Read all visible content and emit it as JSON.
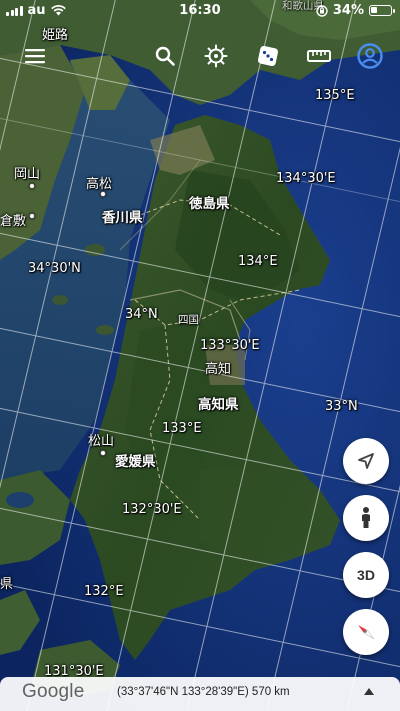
{
  "status_bar": {
    "carrier": "au",
    "time": "16:30",
    "battery": "34%"
  },
  "toolbar": {
    "buttons": [
      "menu-icon",
      "search-icon",
      "voyager-icon",
      "feeling-lucky-icon",
      "measure-icon",
      "account-icon"
    ],
    "accent_color": "#4a8df0"
  },
  "map": {
    "grid_labels": {
      "lon_135": "135°E",
      "lon_134_30": "134°30'E",
      "lon_134": "134°E",
      "lon_133_30": "133°30'E",
      "lon_133": "133°E",
      "lon_132_30": "132°30'E",
      "lon_132": "132°E",
      "lon_131_30": "131°30'E",
      "lat_34_30": "34°30'N",
      "lat_34": "34°N",
      "lat_33": "33°N"
    },
    "places": {
      "himeji": "姫路",
      "wakayama": "和歌山県",
      "okayama": "岡山",
      "kurashiki": "倉敷",
      "takamatsu": "高松",
      "kagawa": "香川県",
      "tokushima": "徳島県",
      "shikoku": "四国",
      "kochi_city": "高知",
      "kochi_pref": "高知県",
      "matsuyama": "松山",
      "ehime": "愛媛県",
      "edge_ken": "県"
    }
  },
  "controls": {
    "button_3d": "3D",
    "compass_colors": [
      "#e53935",
      "#ffffff"
    ]
  },
  "bottom_bar": {
    "logo": "Google",
    "coordinates": "(33°37'46\"N 133°28'39\"E) 570 km"
  }
}
